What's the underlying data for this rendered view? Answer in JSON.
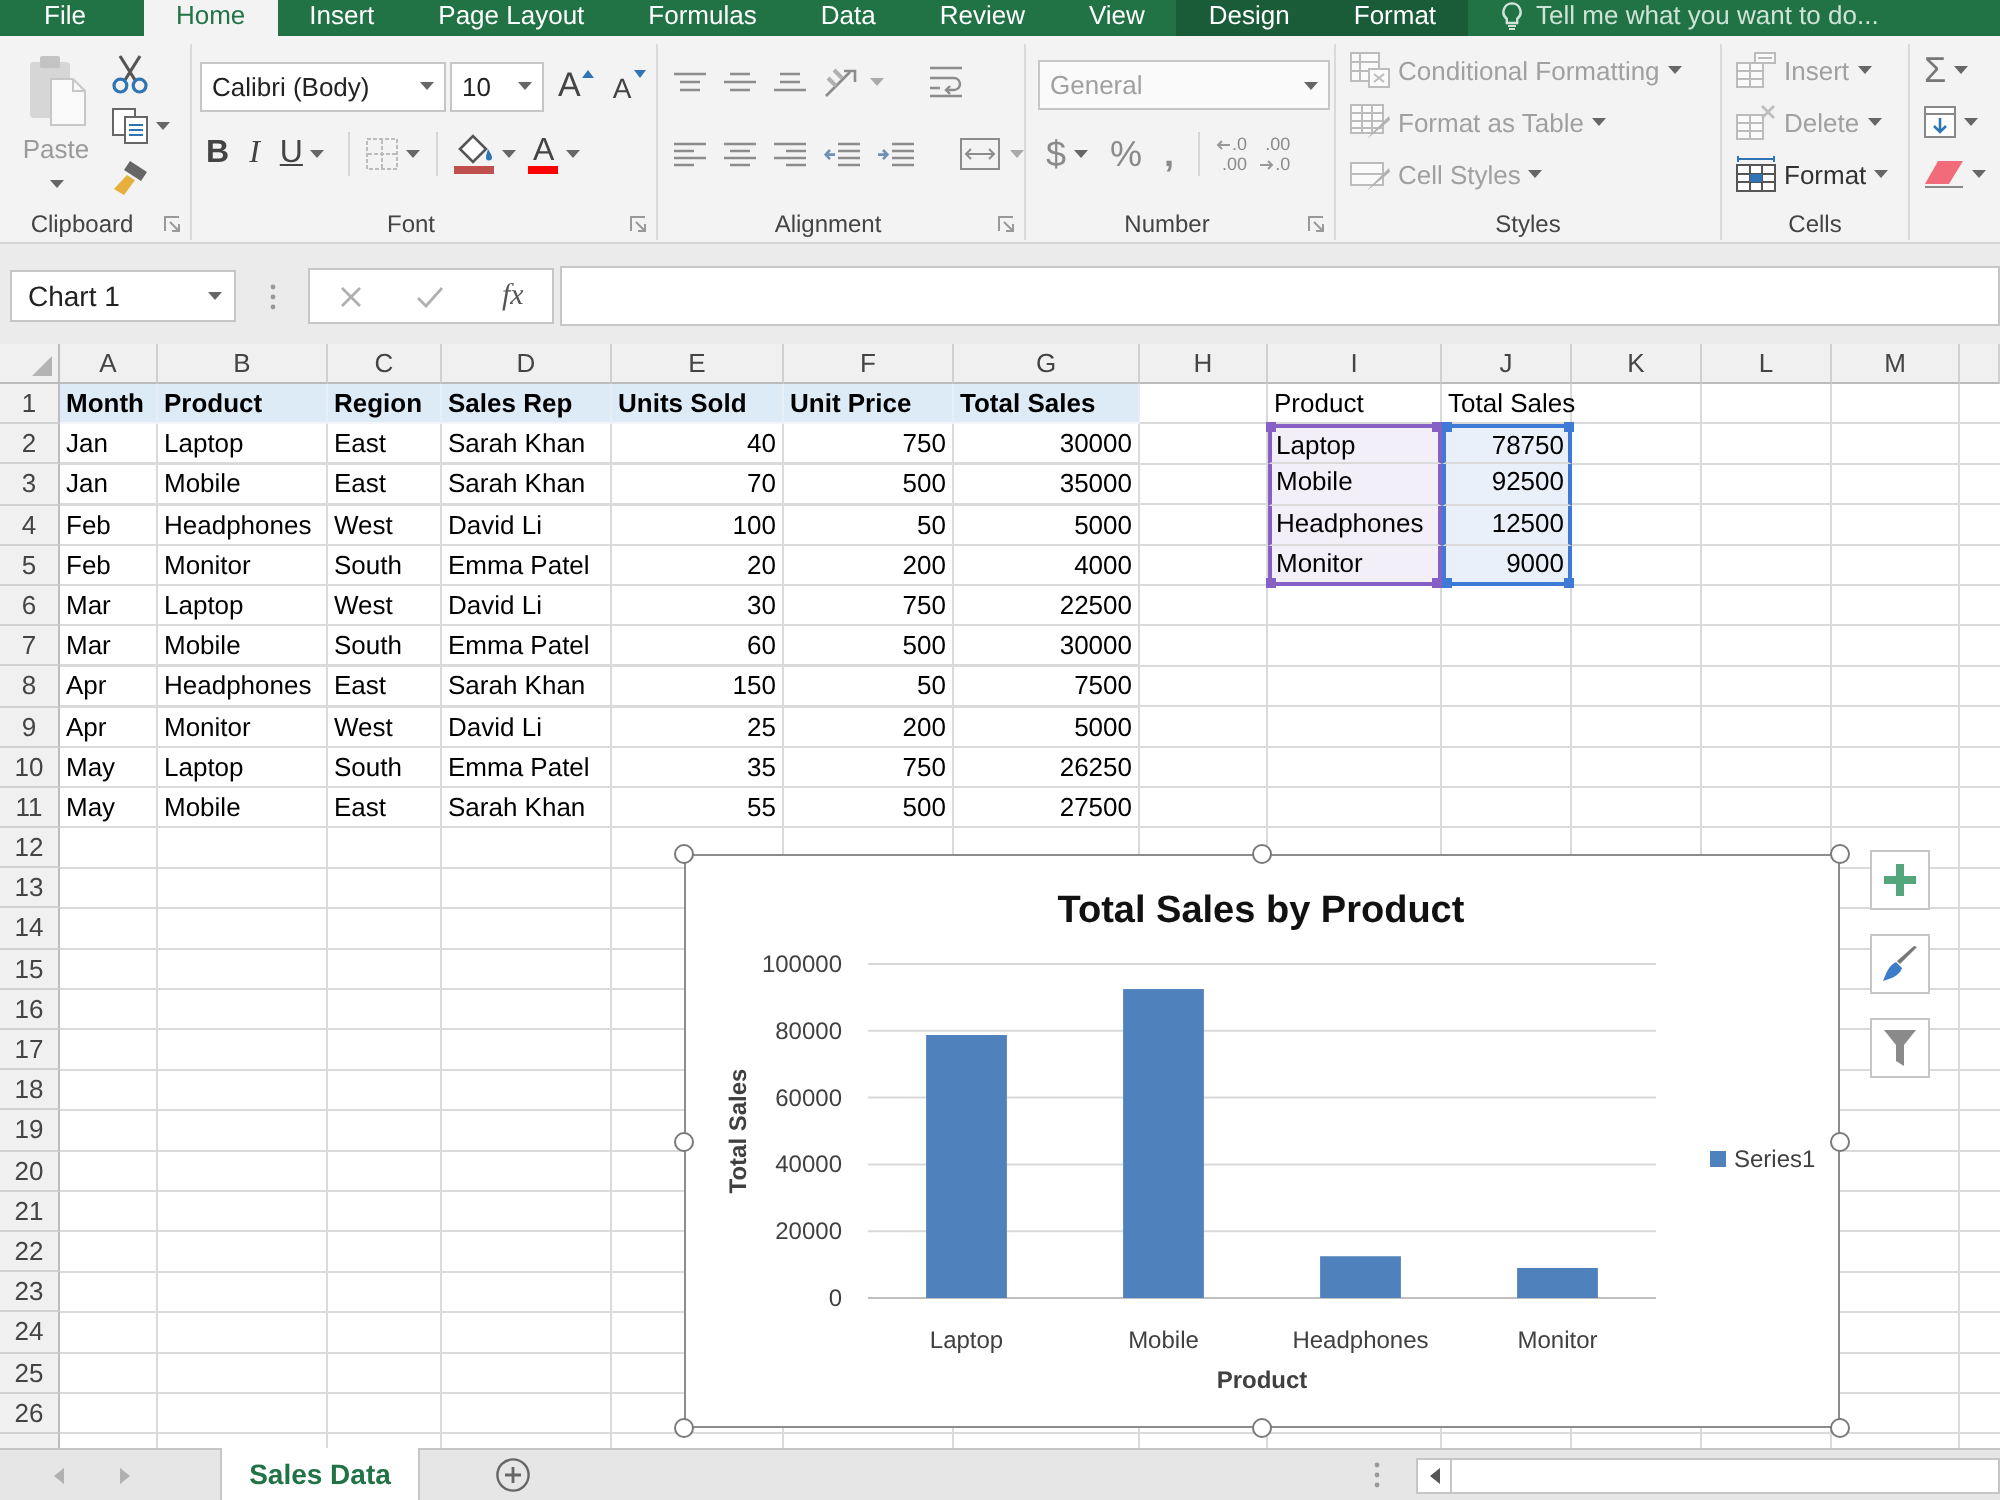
{
  "ribbon": {
    "tabs": [
      {
        "label": "File",
        "kind": "standard",
        "selected": false
      },
      {
        "label": "Home",
        "kind": "standard",
        "selected": true
      },
      {
        "label": "Insert",
        "kind": "standard",
        "selected": false
      },
      {
        "label": "Page Layout",
        "kind": "standard",
        "selected": false
      },
      {
        "label": "Formulas",
        "kind": "standard",
        "selected": false
      },
      {
        "label": "Data",
        "kind": "standard",
        "selected": false
      },
      {
        "label": "Review",
        "kind": "standard",
        "selected": false
      },
      {
        "label": "View",
        "kind": "standard",
        "selected": false
      },
      {
        "label": "Design",
        "kind": "contextual",
        "selected": false
      },
      {
        "label": "Format",
        "kind": "contextual",
        "selected": false
      }
    ],
    "tell_me": {
      "placeholder": "Tell me what you want to do..."
    },
    "clipboard": {
      "paste": {
        "label": "Paste",
        "disabled": true
      },
      "group_label": "Clipboard"
    },
    "font": {
      "font_name": "Calibri (Body)",
      "font_size": "10",
      "grow_label": "A",
      "shrink_label": "A",
      "bold_label": "B",
      "italic_label": "I",
      "underline_label": "U",
      "font_color_label": "A",
      "group_label": "Font"
    },
    "alignment": {
      "group_label": "Alignment"
    },
    "number": {
      "format": {
        "value": "General",
        "disabled": true
      },
      "currency_label": "$",
      "percent_label": "%",
      "comma_label": ",",
      "decimals": [
        {
          "kind": "increase",
          "top": ".0",
          "bottom": ".00"
        },
        {
          "kind": "decrease",
          "top": ".00",
          "bottom": ".0"
        }
      ],
      "group_label": "Number"
    },
    "styles": {
      "items": [
        {
          "kind": "conditional",
          "label": "Conditional Formatting",
          "disabled": true
        },
        {
          "kind": "table",
          "label": "Format as Table",
          "disabled": true
        },
        {
          "kind": "cell_styles",
          "label": "Cell Styles",
          "disabled": true
        }
      ],
      "group_label": "Styles"
    },
    "cells": {
      "items": [
        {
          "kind": "insert",
          "label": "Insert",
          "disabled": true
        },
        {
          "kind": "delete",
          "label": "Delete",
          "disabled": true
        },
        {
          "kind": "format",
          "label": "Format",
          "disabled": false
        }
      ],
      "group_label": "Cells"
    },
    "editing": {
      "autosum_label": "Σ"
    }
  },
  "formula_bar": {
    "name_box": "Chart 1",
    "function_label": "fx"
  },
  "sheet": {
    "column_headers": [
      "A",
      "B",
      "C",
      "D",
      "E",
      "F",
      "G",
      "H",
      "I",
      "J",
      "K",
      "L",
      "M"
    ],
    "row_headers": [
      "1",
      "2",
      "3",
      "4",
      "5",
      "6",
      "7",
      "8",
      "9",
      "10",
      "11",
      "12",
      "13",
      "14",
      "15",
      "16",
      "17",
      "18",
      "19",
      "20",
      "21",
      "22",
      "23",
      "24",
      "25",
      "26"
    ],
    "sales_table": {
      "columns": [
        {
          "label": "Month",
          "kind": "text"
        },
        {
          "label": "Product",
          "kind": "text"
        },
        {
          "label": "Region",
          "kind": "text"
        },
        {
          "label": "Sales Rep",
          "kind": "text"
        },
        {
          "label": "Units Sold",
          "kind": "number"
        },
        {
          "label": "Unit Price",
          "kind": "number"
        },
        {
          "label": "Total Sales",
          "kind": "number"
        }
      ],
      "rows": [
        [
          "Jan",
          "Laptop",
          "East",
          "Sarah Khan",
          "40",
          "750",
          "30000"
        ],
        [
          "Jan",
          "Mobile",
          "East",
          "Sarah Khan",
          "70",
          "500",
          "35000"
        ],
        [
          "Feb",
          "Headphones",
          "West",
          "David Li",
          "100",
          "50",
          "5000"
        ],
        [
          "Feb",
          "Monitor",
          "South",
          "Emma Patel",
          "20",
          "200",
          "4000"
        ],
        [
          "Mar",
          "Laptop",
          "West",
          "David Li",
          "30",
          "750",
          "22500"
        ],
        [
          "Mar",
          "Mobile",
          "South",
          "Emma Patel",
          "60",
          "500",
          "30000"
        ],
        [
          "Apr",
          "Headphones",
          "East",
          "Sarah Khan",
          "150",
          "50",
          "7500"
        ],
        [
          "Apr",
          "Monitor",
          "West",
          "David Li",
          "25",
          "200",
          "5000"
        ],
        [
          "May",
          "Laptop",
          "South",
          "Emma Patel",
          "35",
          "750",
          "26250"
        ],
        [
          "May",
          "Mobile",
          "East",
          "Sarah Khan",
          "55",
          "500",
          "27500"
        ]
      ]
    },
    "summary_table": {
      "columns": [
        {
          "label": "Product",
          "kind": "text"
        },
        {
          "label": "Total Sales",
          "kind": "number"
        }
      ],
      "rows": [
        [
          "Laptop",
          "78750"
        ],
        [
          "Mobile",
          "92500"
        ],
        [
          "Headphones",
          "12500"
        ],
        [
          "Monitor",
          "9000"
        ]
      ]
    },
    "chart": {
      "selected": true,
      "chart_data": {
        "type": "bar",
        "title": "Total Sales by Product",
        "xlabel": "Product",
        "ylabel": "Total Sales",
        "categories": [
          "Laptop",
          "Mobile",
          "Headphones",
          "Monitor"
        ],
        "series": [
          {
            "name": "Series1",
            "color": "#4f81bd",
            "values": [
              78750,
              92500,
              12500,
              9000
            ]
          }
        ],
        "ylim": [
          0,
          100000
        ],
        "yticks": [
          0,
          20000,
          40000,
          60000,
          80000,
          100000
        ],
        "grid": true
      }
    }
  },
  "sheet_tabs": [
    {
      "label": "Sales Data",
      "selected": true
    }
  ]
}
